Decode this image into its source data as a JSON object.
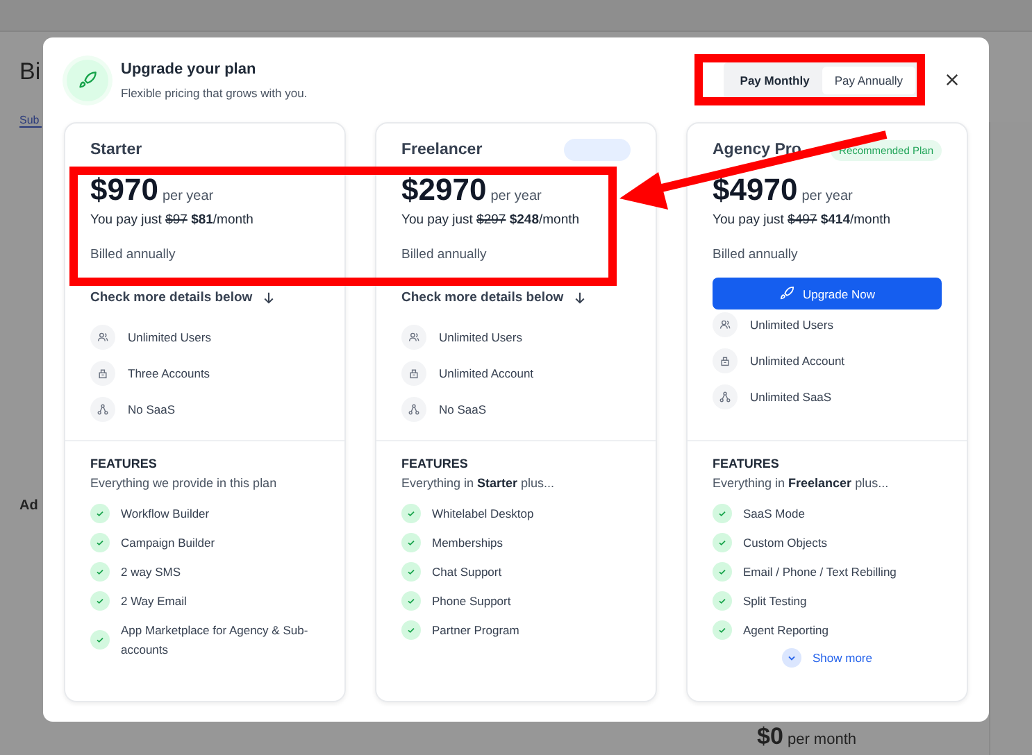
{
  "backdrop": {
    "heading": "Bi",
    "tab": "Sub",
    "section": "Ad",
    "price": "$0",
    "price_unit": "per month"
  },
  "modal": {
    "title": "Upgrade your plan",
    "subtitle": "Flexible pricing that grows with you.",
    "billing_toggle": [
      {
        "label": "Pay Monthly",
        "selected": false
      },
      {
        "label": "Pay Annually",
        "selected": true
      }
    ],
    "plans": [
      {
        "name": "Starter",
        "price": "$970",
        "period": "per year",
        "pay_text": "You pay just",
        "old_price": "$97",
        "new_price": "$81",
        "unit": "/month",
        "billing": "Billed annually",
        "details_link": "Check more details below",
        "limits": [
          {
            "kind": "users",
            "text": "Unlimited Users"
          },
          {
            "kind": "accounts",
            "text": "Three Accounts"
          },
          {
            "kind": "saas",
            "text": "No SaaS"
          }
        ],
        "features_heading": "FEATURES",
        "features_intro": "Everything we provide in this plan",
        "features": [
          "Workflow Builder",
          "Campaign Builder",
          "2 way SMS",
          "2 Way Email",
          "App Marketplace for Agency & Sub-accounts"
        ]
      },
      {
        "name": "Freelancer",
        "tag": {
          "kind": "info"
        },
        "price": "$2970",
        "period": "per year",
        "pay_text": "You pay just",
        "old_price": "$297",
        "new_price": "$248",
        "unit": "/month",
        "billing": "Billed annually",
        "details_link": "Check more details below",
        "limits": [
          {
            "kind": "users",
            "text": "Unlimited Users"
          },
          {
            "kind": "accounts",
            "text": "Unlimited Account"
          },
          {
            "kind": "saas",
            "text": "No SaaS"
          }
        ],
        "features_heading": "FEATURES",
        "features_intro": "Everything in **Starter** plus...",
        "features": [
          "Whitelabel Desktop",
          "Memberships",
          "Chat Support",
          "Phone Support",
          "Partner Program"
        ]
      },
      {
        "name": "Agency Pro",
        "tag": {
          "kind": "success",
          "text": "Recommended Plan"
        },
        "price": "$4970",
        "period": "per year",
        "pay_text": "You pay just",
        "old_price": "$497",
        "new_price": "$414",
        "unit": "/month",
        "billing": "Billed annually",
        "button": "Upgrade Now",
        "limits": [
          {
            "kind": "users",
            "text": "Unlimited Users"
          },
          {
            "kind": "accounts",
            "text": "Unlimited Account"
          },
          {
            "kind": "saas",
            "text": "Unlimited SaaS"
          }
        ],
        "features_heading": "FEATURES",
        "features_intro": "Everything in **Freelancer** plus...",
        "features": [
          "SaaS Mode",
          "Custom Objects",
          "Email / Phone / Text Rebilling",
          "Split Testing",
          "Agent Reporting"
        ],
        "show_more": "Show more"
      }
    ]
  }
}
